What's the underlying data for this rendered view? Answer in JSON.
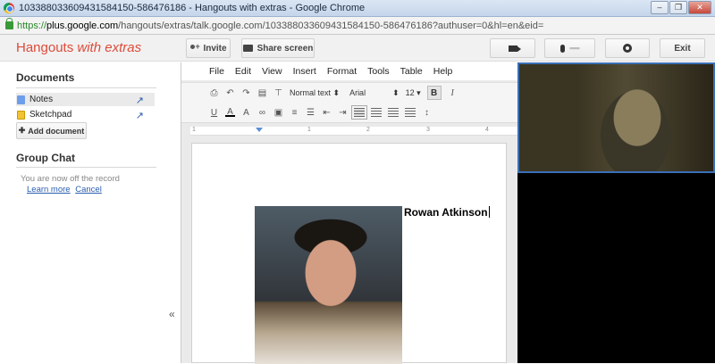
{
  "window": {
    "title": "103388033609431584150-586476186 - Hangouts with extras - Google Chrome",
    "controls": [
      "–",
      "❐",
      "✕"
    ]
  },
  "address": {
    "scheme": "https://",
    "host": "plus.google.com",
    "path": "/hangouts/extras/talk.google.com/103388033609431584150-586476186?authuser=0&hl=en&eid="
  },
  "header": {
    "brand_main": "Hangouts ",
    "brand_em": "with extras",
    "invite_label": "Invite",
    "share_label": "Share screen",
    "mic_level": "▪▪▪▪▪",
    "exit_label": "Exit"
  },
  "sidebar": {
    "documents_title": "Documents",
    "docs": [
      {
        "label": "Notes",
        "selected": true
      },
      {
        "label": "Sketchpad",
        "selected": false
      }
    ],
    "add_document_label": "Add document",
    "group_chat_title": "Group Chat",
    "chat_info": "You are now off the record",
    "learn_more": "Learn more",
    "cancel": "Cancel"
  },
  "editor": {
    "menu": [
      "File",
      "Edit",
      "View",
      "Insert",
      "Format",
      "Tools",
      "Table",
      "Help"
    ],
    "style_value": "Normal text",
    "font_value": "Arial",
    "size_value": "12",
    "ruler_marks": [
      "1",
      "1",
      "2",
      "3",
      "4"
    ],
    "document_text": "Rowan Atkinson"
  },
  "colors": {
    "brand": "#dd4b39",
    "link": "#2a5db0",
    "video_border": "#3b6fb6"
  }
}
